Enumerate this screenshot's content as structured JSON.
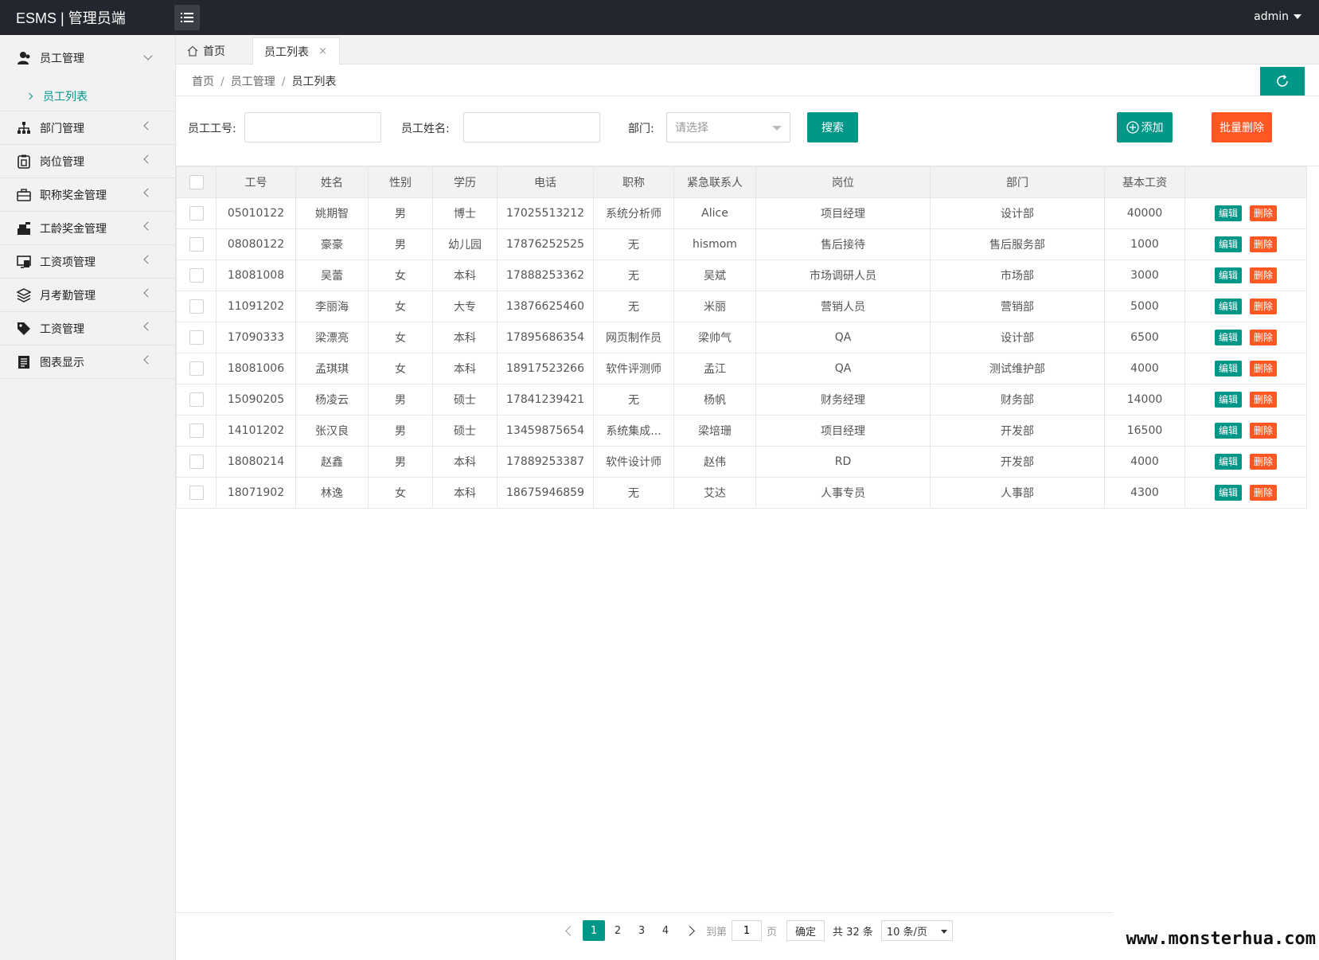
{
  "app": {
    "title": "ESMS | 管理员端",
    "user": "admin"
  },
  "sidebar": {
    "groups": [
      {
        "label": "员工管理",
        "icon": "user-group-icon",
        "open": true,
        "sub": [
          {
            "label": "员工列表"
          }
        ]
      },
      {
        "label": "部门管理",
        "icon": "org-chart-icon"
      },
      {
        "label": "岗位管理",
        "icon": "badge-icon"
      },
      {
        "label": "职称奖金管理",
        "icon": "briefcase-icon"
      },
      {
        "label": "工龄奖金管理",
        "icon": "cash-register-icon"
      },
      {
        "label": "工资项管理",
        "icon": "monitor-icon"
      },
      {
        "label": "月考勤管理",
        "icon": "layers-icon"
      },
      {
        "label": "工资管理",
        "icon": "tag-icon"
      },
      {
        "label": "图表显示",
        "icon": "document-icon"
      }
    ]
  },
  "tabs": {
    "home": "首页",
    "active": "员工列表",
    "close": "×"
  },
  "breadcrumb": {
    "items": [
      "首页",
      "员工管理",
      "员工列表"
    ],
    "sep": "/"
  },
  "search": {
    "id_label": "员工工号:",
    "name_label": "员工姓名:",
    "dept_label": "部门:",
    "dept_placeholder": "请选择",
    "search_btn": "搜索",
    "add_btn": "添加",
    "batch_delete_btn": "批量删除"
  },
  "table": {
    "columns": [
      "工号",
      "姓名",
      "性别",
      "学历",
      "电话",
      "职称",
      "紧急联系人",
      "岗位",
      "部门",
      "基本工资"
    ],
    "edit_label": "编辑",
    "delete_label": "删除",
    "rows": [
      [
        "05010122",
        "姚期智",
        "男",
        "博士",
        "17025513212",
        "系统分析师",
        "Alice",
        "项目经理",
        "设计部",
        "40000"
      ],
      [
        "08080122",
        "豪豪",
        "男",
        "幼儿园",
        "17876252525",
        "无",
        "hismom",
        "售后接待",
        "售后服务部",
        "1000"
      ],
      [
        "18081008",
        "吴蕾",
        "女",
        "本科",
        "17888253362",
        "无",
        "吴斌",
        "市场调研人员",
        "市场部",
        "3000"
      ],
      [
        "11091202",
        "李丽海",
        "女",
        "大专",
        "13876625460",
        "无",
        "米丽",
        "营销人员",
        "营销部",
        "5000"
      ],
      [
        "17090333",
        "梁漂亮",
        "女",
        "本科",
        "17895686354",
        "网页制作员",
        "梁帅气",
        "QA",
        "设计部",
        "6500"
      ],
      [
        "18081006",
        "孟琪琪",
        "女",
        "本科",
        "18917523266",
        "软件评测师",
        "孟江",
        "QA",
        "测试维护部",
        "4000"
      ],
      [
        "15090205",
        "杨凌云",
        "男",
        "硕士",
        "17841239421",
        "无",
        "杨帆",
        "财务经理",
        "财务部",
        "14000"
      ],
      [
        "14101202",
        "张汉良",
        "男",
        "硕士",
        "13459875654",
        "系统集成...",
        "梁培珊",
        "项目经理",
        "开发部",
        "16500"
      ],
      [
        "18080214",
        "赵鑫",
        "男",
        "本科",
        "17889253387",
        "软件设计师",
        "赵伟",
        "RD",
        "开发部",
        "4000"
      ],
      [
        "18071902",
        "林逸",
        "女",
        "本科",
        "18675946859",
        "无",
        "艾达",
        "人事专员",
        "人事部",
        "4300"
      ]
    ]
  },
  "pagination": {
    "pages": [
      "1",
      "2",
      "3",
      "4"
    ],
    "current": "1",
    "goto_label": "到第",
    "goto_value": "1",
    "page_label": "页",
    "confirm": "确定",
    "total": "共 32 条",
    "per_page": "10 条/页"
  },
  "watermark": "www.monsterhua.com",
  "colors": {
    "primary": "#009688",
    "danger": "#ff5722",
    "header": "#23262e"
  }
}
